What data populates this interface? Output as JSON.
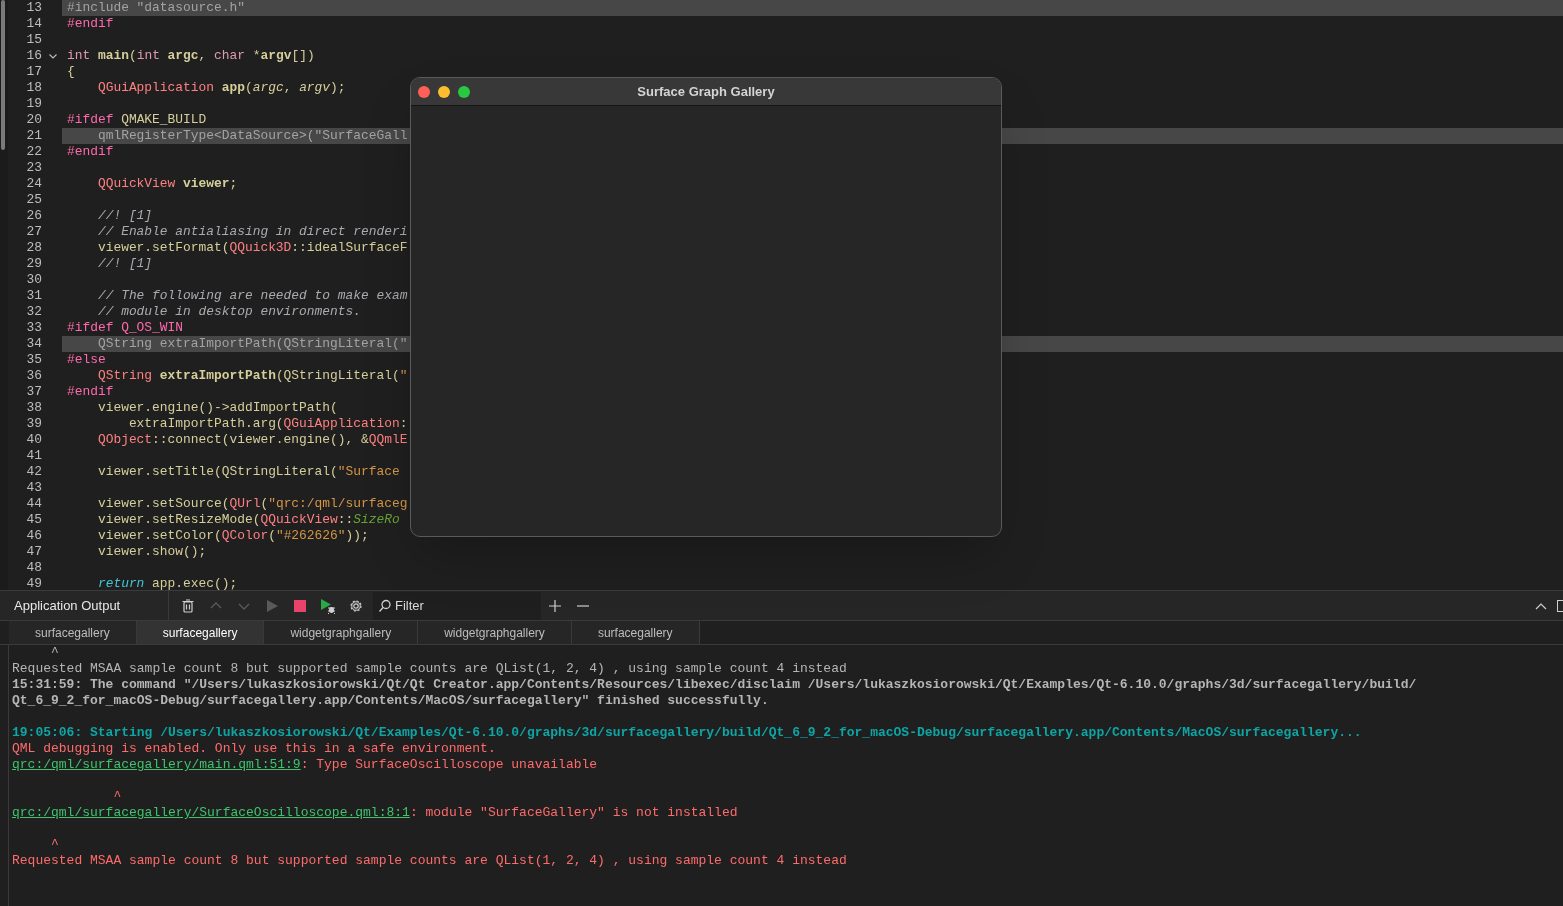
{
  "editor": {
    "lines": [
      {
        "number": "13",
        "fold": false,
        "inactive": true,
        "text": "#include \"datasource.h\""
      },
      {
        "number": "14",
        "fold": false,
        "inactive": false,
        "tokens": [
          {
            "kind": "pre",
            "text": "#endif"
          }
        ]
      },
      {
        "number": "15",
        "fold": false,
        "inactive": false
      },
      {
        "number": "16",
        "fold": true,
        "inactive": false,
        "tokens": [
          {
            "kind": "kw",
            "text": "int"
          },
          {
            "kind": "fn",
            "text": " main"
          },
          {
            "kind": "plain",
            "text": "("
          },
          {
            "kind": "kw",
            "text": "int"
          },
          {
            "kind": "fn",
            "text": " argc"
          },
          {
            "kind": "plain",
            "text": ", "
          },
          {
            "kind": "kw",
            "text": "char"
          },
          {
            "kind": "plain",
            "text": " *"
          },
          {
            "kind": "fn",
            "text": "argv"
          },
          {
            "kind": "plain",
            "text": "[])"
          }
        ]
      },
      {
        "number": "17",
        "fold": false,
        "inactive": false,
        "tokens": [
          {
            "kind": "plain",
            "text": "{"
          }
        ]
      },
      {
        "number": "18",
        "fold": false,
        "inactive": false,
        "tokens": [
          {
            "kind": "type",
            "text": "    QGuiApplication"
          },
          {
            "kind": "fn",
            "text": " app"
          },
          {
            "kind": "plain",
            "text": "("
          },
          {
            "kind": "param",
            "text": "argc"
          },
          {
            "kind": "plain",
            "text": ", "
          },
          {
            "kind": "param",
            "text": "argv"
          },
          {
            "kind": "plain",
            "text": ");"
          }
        ]
      },
      {
        "number": "19",
        "fold": false,
        "inactive": false
      },
      {
        "number": "20",
        "fold": false,
        "inactive": false,
        "tokens": [
          {
            "kind": "pre",
            "text": "#ifdef"
          },
          {
            "kind": "plain",
            "text": " QMAKE_BUILD"
          }
        ]
      },
      {
        "number": "21",
        "fold": false,
        "inactive": true,
        "text": "    qmlRegisterType<DataSource>(\"SurfaceGall"
      },
      {
        "number": "22",
        "fold": false,
        "inactive": false,
        "tokens": [
          {
            "kind": "pre",
            "text": "#endif"
          }
        ]
      },
      {
        "number": "23",
        "fold": false,
        "inactive": false
      },
      {
        "number": "24",
        "fold": false,
        "inactive": false,
        "tokens": [
          {
            "kind": "type",
            "text": "    QQuickView"
          },
          {
            "kind": "fn",
            "text": " viewer"
          },
          {
            "kind": "plain",
            "text": ";"
          }
        ]
      },
      {
        "number": "25",
        "fold": false,
        "inactive": false
      },
      {
        "number": "26",
        "fold": false,
        "inactive": false,
        "tokens": [
          {
            "kind": "comment",
            "text": "    //! [1]"
          }
        ]
      },
      {
        "number": "27",
        "fold": false,
        "inactive": false,
        "tokens": [
          {
            "kind": "comment",
            "text": "    // Enable antialiasing in direct renderi"
          }
        ]
      },
      {
        "number": "28",
        "fold": false,
        "inactive": false,
        "tokens": [
          {
            "kind": "plain",
            "text": "    viewer.setFormat("
          },
          {
            "kind": "type",
            "text": "QQuick3D"
          },
          {
            "kind": "plain",
            "text": "::idealSurfaceF"
          }
        ]
      },
      {
        "number": "29",
        "fold": false,
        "inactive": false,
        "tokens": [
          {
            "kind": "comment",
            "text": "    //! [1]"
          }
        ]
      },
      {
        "number": "30",
        "fold": false,
        "inactive": false
      },
      {
        "number": "31",
        "fold": false,
        "inactive": false,
        "tokens": [
          {
            "kind": "comment",
            "text": "    // The following are needed to make exam"
          }
        ]
      },
      {
        "number": "32",
        "fold": false,
        "inactive": false,
        "tokens": [
          {
            "kind": "comment",
            "text": "    // module in desktop environments."
          }
        ]
      },
      {
        "number": "33",
        "fold": false,
        "inactive": false,
        "tokens": [
          {
            "kind": "pre",
            "text": "#ifdef Q_OS_WIN"
          }
        ]
      },
      {
        "number": "34",
        "fold": false,
        "inactive": true,
        "text": "    QString extraImportPath(QStringLiteral(\""
      },
      {
        "number": "35",
        "fold": false,
        "inactive": false,
        "tokens": [
          {
            "kind": "pre",
            "text": "#else"
          }
        ]
      },
      {
        "number": "36",
        "fold": false,
        "inactive": false,
        "tokens": [
          {
            "kind": "type",
            "text": "    QString"
          },
          {
            "kind": "fn",
            "text": " extraImportPath"
          },
          {
            "kind": "plain",
            "text": "(QStringLiteral("
          },
          {
            "kind": "string",
            "text": "\""
          }
        ]
      },
      {
        "number": "37",
        "fold": false,
        "inactive": false,
        "tokens": [
          {
            "kind": "pre",
            "text": "#endif"
          }
        ]
      },
      {
        "number": "38",
        "fold": false,
        "inactive": false,
        "tokens": [
          {
            "kind": "plain",
            "text": "    viewer.engine()->addImportPath("
          }
        ]
      },
      {
        "number": "39",
        "fold": false,
        "inactive": false,
        "tokens": [
          {
            "kind": "plain",
            "text": "        extraImportPath.arg("
          },
          {
            "kind": "type",
            "text": "QGuiApplication"
          },
          {
            "kind": "plain",
            "text": ":"
          }
        ]
      },
      {
        "number": "40",
        "fold": false,
        "inactive": false,
        "tokens": [
          {
            "kind": "type",
            "text": "    QObject"
          },
          {
            "kind": "plain",
            "text": "::connect(viewer.engine(), &"
          },
          {
            "kind": "type",
            "text": "QQmlE"
          }
        ]
      },
      {
        "number": "41",
        "fold": false,
        "inactive": false
      },
      {
        "number": "42",
        "fold": false,
        "inactive": false,
        "tokens": [
          {
            "kind": "plain",
            "text": "    viewer.setTitle(QStringLiteral("
          },
          {
            "kind": "string",
            "text": "\"Surface"
          }
        ]
      },
      {
        "number": "43",
        "fold": false,
        "inactive": false
      },
      {
        "number": "44",
        "fold": false,
        "inactive": false,
        "tokens": [
          {
            "kind": "plain",
            "text": "    viewer.setSource("
          },
          {
            "kind": "type",
            "text": "QUrl"
          },
          {
            "kind": "plain",
            "text": "("
          },
          {
            "kind": "string",
            "text": "\"qrc:/qml/surfaceg"
          }
        ]
      },
      {
        "number": "45",
        "fold": false,
        "inactive": false,
        "tokens": [
          {
            "kind": "plain",
            "text": "    viewer.setResizeMode("
          },
          {
            "kind": "type",
            "text": "QQuickView"
          },
          {
            "kind": "plain",
            "text": "::"
          },
          {
            "kind": "enum",
            "text": "SizeRo"
          }
        ]
      },
      {
        "number": "46",
        "fold": false,
        "inactive": false,
        "tokens": [
          {
            "kind": "plain",
            "text": "    viewer.setColor("
          },
          {
            "kind": "type",
            "text": "QColor"
          },
          {
            "kind": "plain",
            "text": "("
          },
          {
            "kind": "string",
            "text": "\"#262626\""
          },
          {
            "kind": "plain",
            "text": "));"
          }
        ]
      },
      {
        "number": "47",
        "fold": false,
        "inactive": false,
        "tokens": [
          {
            "kind": "plain",
            "text": "    viewer.show();"
          }
        ]
      },
      {
        "number": "48",
        "fold": false,
        "inactive": false
      },
      {
        "number": "49",
        "fold": false,
        "inactive": false,
        "tokens": [
          {
            "kind": "ret",
            "text": "    return"
          },
          {
            "kind": "plain",
            "text": " app.exec();"
          }
        ]
      }
    ]
  },
  "app_window": {
    "title": "Surface Graph Gallery"
  },
  "output_pane": {
    "title": "Application Output",
    "toolbar": [
      {
        "kind": "clear",
        "disabled": false
      },
      {
        "kind": "up",
        "disabled": true
      },
      {
        "kind": "down",
        "disabled": true
      },
      {
        "kind": "run",
        "disabled": true
      },
      {
        "kind": "stop",
        "disabled": false
      },
      {
        "kind": "debug",
        "disabled": false
      },
      {
        "kind": "settings",
        "disabled": false
      }
    ],
    "filter": {
      "placeholder": "Filter"
    },
    "tabs": [
      {
        "label": "surfacegallery",
        "selected": false
      },
      {
        "label": "surfacegallery",
        "selected": true
      },
      {
        "label": "widgetgraphgallery",
        "selected": false
      },
      {
        "label": "widgetgraphgallery",
        "selected": false
      },
      {
        "label": "surfacegallery",
        "selected": false
      }
    ],
    "blocks": [
      {
        "lines": [
          {
            "kind": "normal",
            "text": "     ^"
          },
          {
            "kind": "normal",
            "text": "Requested MSAA sample count 8 but supported sample counts are QList(1, 2, 4) , using sample count 4 instead"
          },
          {
            "kind": "bold",
            "text": "15:31:59: The command \"/Users/lukaszkosiorowski/Qt/Qt Creator.app/Contents/Resources/libexec/disclaim /Users/lukaszkosiorowski/Qt/Examples/Qt-6.10.0/graphs/3d/surfacegallery/build/"
          },
          {
            "kind": "bold",
            "text": "Qt_6_9_2_for_macOS-Debug/surfacegallery.app/Contents/MacOS/surfacegallery\" finished successfully."
          }
        ]
      },
      {
        "lines": [
          {
            "kind": "start",
            "text": "19:05:06: Starting /Users/lukaszkosiorowski/Qt/Examples/Qt-6.10.0/graphs/3d/surfacegallery/build/Qt_6_9_2_for_macOS-Debug/surfacegallery.app/Contents/MacOS/surfacegallery..."
          },
          {
            "kind": "error",
            "text": "QML debugging is enabled. Only use this in a safe environment."
          },
          {
            "kind": "error",
            "link": "qrc:/qml/surfacegallery/main.qml:51:9",
            "text": ": Type SurfaceOscilloscope unavailable"
          }
        ]
      },
      {
        "lines": [
          {
            "kind": "error",
            "text": "             ^"
          },
          {
            "kind": "error",
            "link": "qrc:/qml/surfacegallery/SurfaceOscilloscope.qml:8:1",
            "text": ": module \"SurfaceGallery\" is not installed"
          }
        ]
      },
      {
        "lines": [
          {
            "kind": "error",
            "text": "     ^"
          },
          {
            "kind": "error",
            "text": "Requested MSAA sample count 8 but supported sample counts are QList(1, 2, 4) , using sample count 4 instead"
          }
        ]
      }
    ]
  }
}
